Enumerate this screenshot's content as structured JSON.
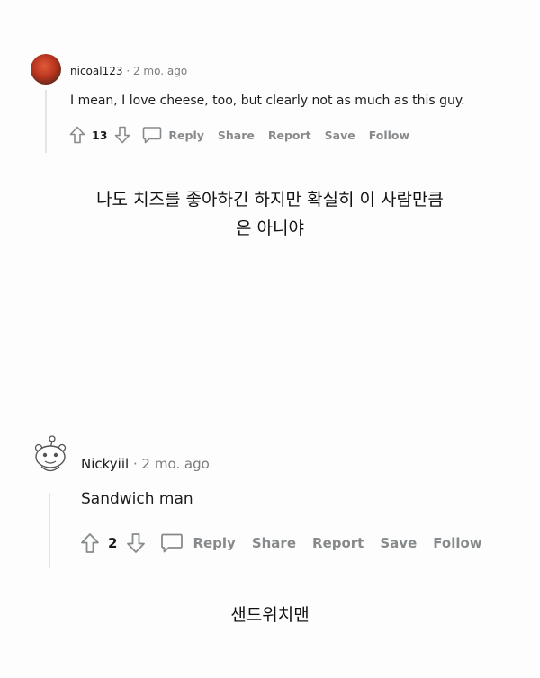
{
  "comments": [
    {
      "username": "nicoal123",
      "separator": "·",
      "time": "2 mo. ago",
      "text": "I mean, I love cheese, too, but clearly not as much as this guy.",
      "votes": "13",
      "actions": {
        "reply": "Reply",
        "share": "Share",
        "report": "Report",
        "save": "Save",
        "follow": "Follow"
      }
    },
    {
      "username": "Nickyiil",
      "separator": "·",
      "time": "2 mo. ago",
      "text": "Sandwich man",
      "votes": "2",
      "actions": {
        "reply": "Reply",
        "share": "Share",
        "report": "Report",
        "save": "Save",
        "follow": "Follow"
      }
    }
  ],
  "captions": {
    "first_line1": "나도 치즈를 좋아하긴 하지만 확실히 이 사람만큼",
    "first_line2": "은 아니야",
    "second": "샌드위치맨"
  },
  "colors": {
    "meta_gray": "#7c7c7c",
    "action_gray": "#878a8c",
    "thread_line": "#e4e4e4"
  },
  "icons": [
    "upvote-icon",
    "downvote-icon",
    "comment-bubble-icon",
    "snoo-avatar-icon"
  ]
}
